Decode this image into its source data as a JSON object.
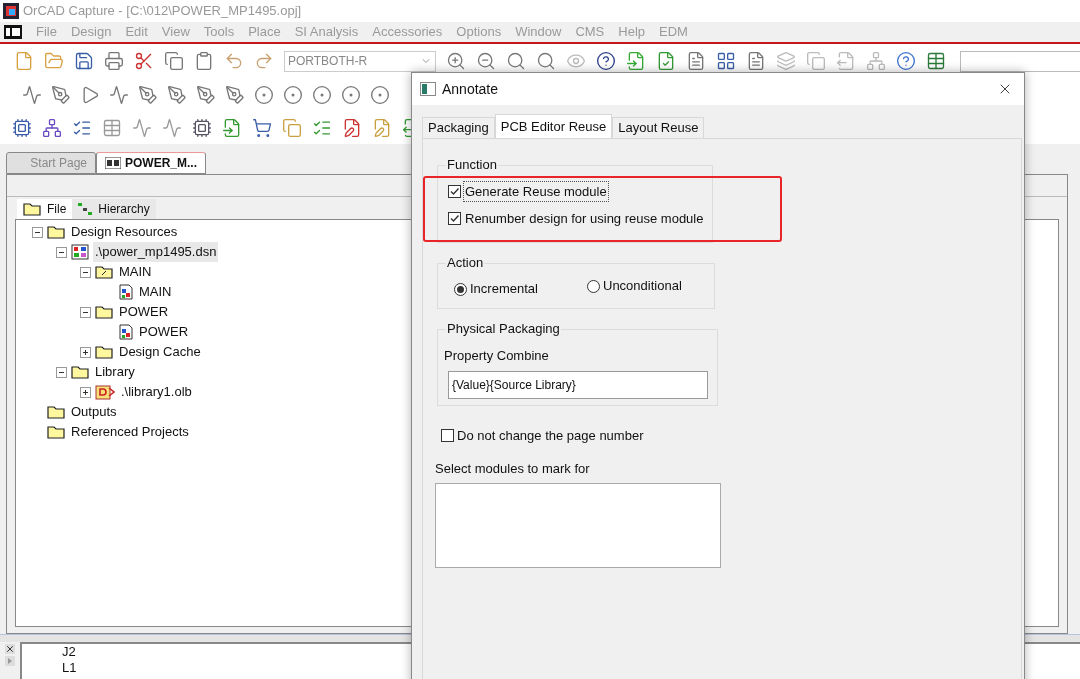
{
  "window": {
    "title": "OrCAD Capture - [C:\\012\\POWER_MP1495.opj]"
  },
  "menu": [
    "File",
    "Design",
    "Edit",
    "View",
    "Tools",
    "Place",
    "SI Analysis",
    "Accessories",
    "Options",
    "Window",
    "CMS",
    "Help",
    "EDM"
  ],
  "toolbar": {
    "part_combo": "PORTBOTH-R"
  },
  "project": {
    "tabs": [
      {
        "label": "Start Page",
        "selected": false
      },
      {
        "label": "POWER_M...",
        "selected": true
      }
    ],
    "view_tabs": [
      {
        "label": "File",
        "selected": true
      },
      {
        "label": "Hierarchy",
        "selected": false
      }
    ],
    "tree": [
      {
        "label": "Design Resources",
        "kind": "folder",
        "expanded": true,
        "children": [
          {
            "label": ".\\power_mp1495.dsn",
            "kind": "design",
            "expanded": true,
            "selected": true,
            "children": [
              {
                "label": "MAIN",
                "kind": "schematic",
                "expanded": true,
                "children": [
                  {
                    "label": "MAIN",
                    "kind": "page"
                  }
                ]
              },
              {
                "label": "POWER",
                "kind": "folder",
                "expanded": true,
                "children": [
                  {
                    "label": "POWER",
                    "kind": "page"
                  }
                ]
              },
              {
                "label": "Design Cache",
                "kind": "folder",
                "expanded": false
              }
            ]
          },
          {
            "label": "Library",
            "kind": "folder",
            "expanded": true,
            "children": [
              {
                "label": ".\\library1.olb",
                "kind": "library",
                "expanded": false
              }
            ]
          }
        ]
      },
      {
        "label": "Outputs",
        "kind": "folder"
      },
      {
        "label": "Referenced Projects",
        "kind": "folder"
      }
    ]
  },
  "session_log": [
    "J2",
    "L1"
  ],
  "dialog": {
    "title": "Annotate",
    "tabs": [
      {
        "label": "Packaging",
        "selected": false
      },
      {
        "label": "PCB Editor Reuse",
        "selected": true
      },
      {
        "label": "Layout Reuse",
        "selected": false
      }
    ],
    "function": {
      "label": "Function",
      "options": [
        {
          "label": "Generate Reuse module",
          "checked": true,
          "focused": true
        },
        {
          "label": "Renumber design for using reuse module",
          "checked": true,
          "focused": false
        }
      ]
    },
    "action": {
      "label": "Action",
      "options": [
        {
          "label": "Incremental",
          "selected": true
        },
        {
          "label": "Unconditional",
          "selected": false
        }
      ]
    },
    "physical_packaging": {
      "label": "Physical Packaging",
      "field_label": "Property Combine",
      "value": "{Value}{Source Library}"
    },
    "keep_page_number": {
      "label": "Do not change the page number",
      "checked": false
    },
    "modules": {
      "label": "Select modules to mark for"
    }
  }
}
